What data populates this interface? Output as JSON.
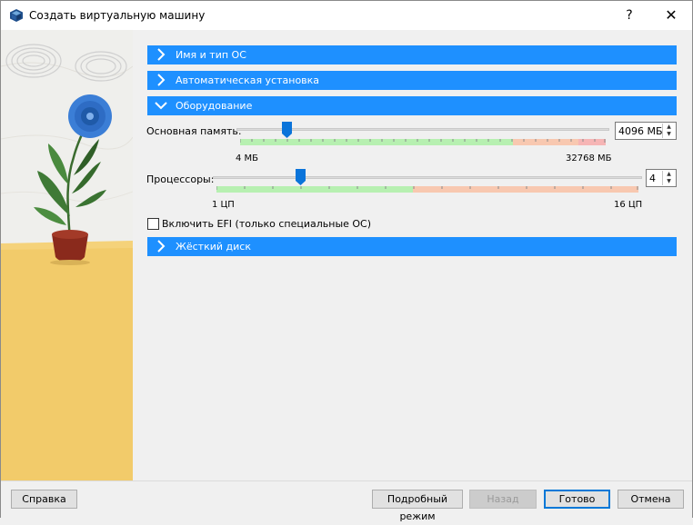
{
  "window": {
    "title": "Создать виртуальную машину",
    "help_glyph": "?",
    "close_glyph": "✕"
  },
  "sections": {
    "name_os": "Имя и тип ОС",
    "unattended": "Автоматическая установка",
    "hardware": "Оборудование",
    "disk": "Жёсткий диск"
  },
  "hardware": {
    "memory": {
      "label": "Основная память:",
      "value": "4096 МБ",
      "min_label": "4 МБ",
      "max_label": "32768 МБ",
      "position_fraction": 0.125
    },
    "cpu": {
      "label": "Процессоры:",
      "value": "4",
      "min_label": "1 ЦП",
      "max_label": "16 ЦП",
      "position_fraction": 0.2
    },
    "efi": {
      "label": "Включить EFI (только специальные ОС)",
      "checked": false
    }
  },
  "footer": {
    "help": "Справка",
    "expert": "Подробный режим",
    "back": "Назад",
    "finish": "Готово",
    "cancel": "Отмена"
  },
  "colors": {
    "section_bg": "#1e90ff",
    "scale_green": "#b7f0b1",
    "scale_orange": "#f8c8b0",
    "scale_red": "#f6b5b5",
    "slider_thumb": "#0a74da"
  }
}
